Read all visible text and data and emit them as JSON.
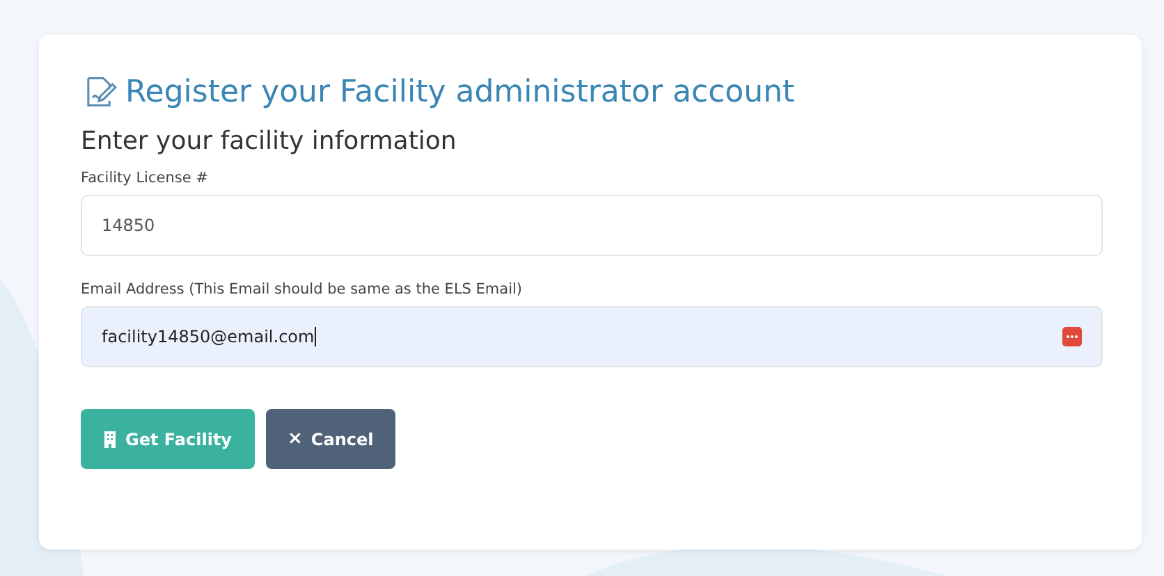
{
  "title": "Register your Facility administrator account",
  "subtitle": "Enter your facility information",
  "fields": [
    {
      "label": "Facility License #",
      "value": "14850",
      "focused": false
    },
    {
      "label": "Email Address (This Email should be same as the ELS Email)",
      "value": "facility14850@email.com",
      "focused": true
    }
  ],
  "buttons": [
    {
      "kind": "primary",
      "label": "Get Facility"
    },
    {
      "kind": "secondary",
      "icon": "×",
      "label": "Cancel"
    }
  ]
}
